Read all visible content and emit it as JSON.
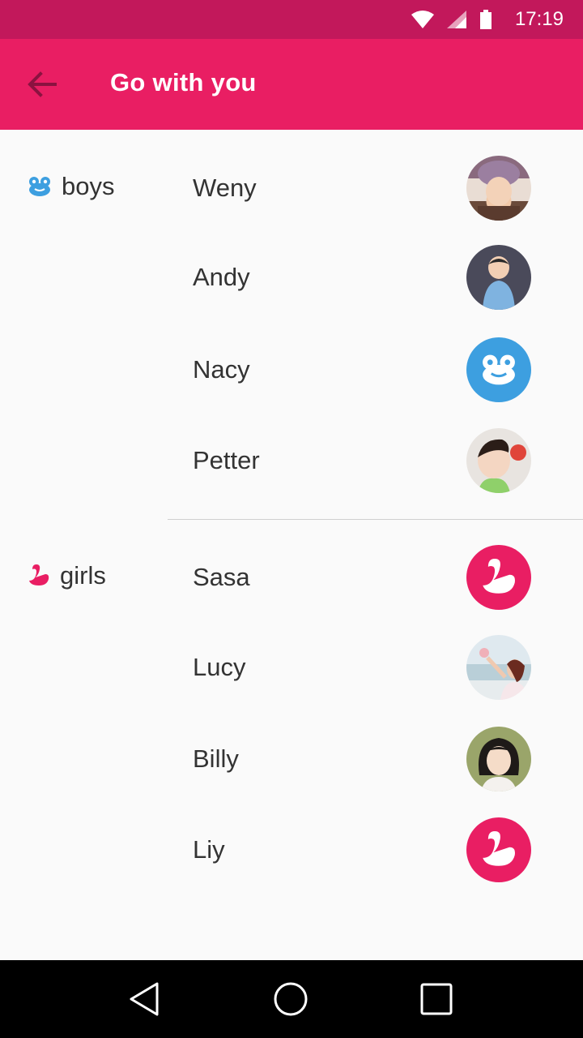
{
  "status_bar": {
    "time": "17:19",
    "icons": [
      "wifi-icon",
      "signal-icon",
      "battery-icon"
    ]
  },
  "app_bar": {
    "title": "Go with you",
    "back_icon": "arrow-back-icon"
  },
  "colors": {
    "primary": "#e91e63",
    "primary_dark": "#c2185b",
    "frog_blue": "#3d9fe0",
    "text": "#333333"
  },
  "groups": [
    {
      "label": "boys",
      "icon": "frog-icon",
      "members": [
        {
          "name": "Weny",
          "avatar": "photo"
        },
        {
          "name": "Andy",
          "avatar": "photo"
        },
        {
          "name": "Nacy",
          "avatar": "frog-icon"
        },
        {
          "name": "Petter",
          "avatar": "photo"
        }
      ]
    },
    {
      "label": "girls",
      "icon": "swan-icon",
      "members": [
        {
          "name": "Sasa",
          "avatar": "swan-icon"
        },
        {
          "name": "Lucy",
          "avatar": "photo"
        },
        {
          "name": "Billy",
          "avatar": "photo"
        },
        {
          "name": "Liy",
          "avatar": "swan-icon"
        }
      ]
    }
  ],
  "nav_bar": {
    "buttons": [
      "nav-back-icon",
      "nav-home-icon",
      "nav-recents-icon"
    ]
  }
}
